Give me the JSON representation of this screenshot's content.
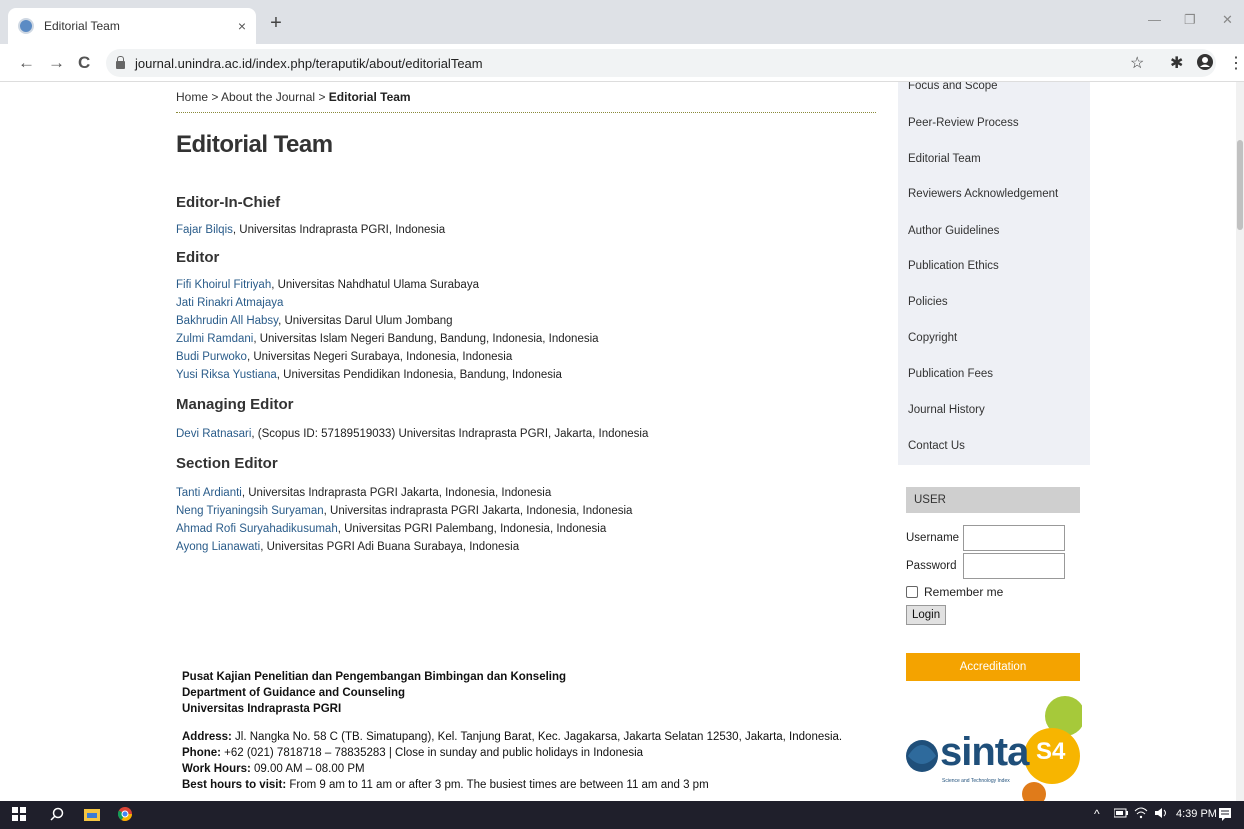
{
  "browser": {
    "tab_title": "Editorial Team",
    "tab_close": "×",
    "new_tab": "+",
    "url": "journal.unindra.ac.id/index.php/teraputik/about/editorialTeam",
    "back": "←",
    "forward": "→",
    "reload": "C",
    "star": "☆",
    "extensions": "✱",
    "menu": "⋮",
    "min": "—",
    "restore": "❐",
    "close": "✕"
  },
  "breadcrumb": {
    "home": "Home",
    "sep1": " > ",
    "about": "About the Journal",
    "sep2": " > ",
    "current": "Editorial Team"
  },
  "page_title": "Editorial Team",
  "sections": {
    "chief": {
      "heading": "Editor-In-Chief",
      "entries": [
        {
          "name": "Fajar Bilqis",
          "aff": ", Universitas Indraprasta PGRI, Indonesia"
        }
      ]
    },
    "editor": {
      "heading": "Editor",
      "entries": [
        {
          "name": "Fifi Khoirul Fitriyah",
          "aff": ", Universitas Nahdhatul Ulama Surabaya"
        },
        {
          "name": "Jati Rinakri Atmajaya",
          "aff": ""
        },
        {
          "name": "Bakhrudin All Habsy",
          "aff": ", Universitas Darul Ulum Jombang"
        },
        {
          "name": "Zulmi Ramdani",
          "aff": ", Universitas Islam Negeri Bandung, Bandung, Indonesia, Indonesia"
        },
        {
          "name": "Budi Purwoko",
          "aff": ", Universitas Negeri Surabaya, Indonesia, Indonesia"
        },
        {
          "name": "Yusi Riksa Yustiana",
          "aff": ", Universitas Pendidikan Indonesia, Bandung, Indonesia"
        }
      ]
    },
    "managing": {
      "heading": "Managing Editor",
      "entries": [
        {
          "name": "Devi Ratnasari",
          "aff": ", (Scopus ID: 57189519033) Universitas Indraprasta PGRI, Jakarta, Indonesia"
        }
      ]
    },
    "section": {
      "heading": "Section Editor",
      "entries": [
        {
          "name": "Tanti Ardianti",
          "aff": ", Universitas Indraprasta PGRI Jakarta, Indonesia, Indonesia"
        },
        {
          "name": "Neng Triyaningsih Suryaman",
          "aff": ", Universitas indraprasta PGRI Jakarta, Indonesia, Indonesia"
        },
        {
          "name": "Ahmad Rofi Suryahadikusumah",
          "aff": ", Universitas PGRI Palembang, Indonesia, Indonesia"
        },
        {
          "name": "Ayong Lianawati",
          "aff": ", Universitas PGRI Adi Buana Surabaya, Indonesia"
        }
      ]
    }
  },
  "footer": {
    "inst1": "Pusat Kajian Penelitian dan Pengembangan Bimbingan dan Konseling",
    "inst2": "Department of Guidance and Counseling",
    "inst3": "Universitas Indraprasta PGRI",
    "address_label": "Address:",
    "address": " Jl. Nangka No. 58 C (TB. Simatupang), Kel. Tanjung Barat, Kec. Jagakarsa, Jakarta Selatan 12530, Jakarta, Indonesia.",
    "phone_label": "Phone:",
    "phone": " +62 (021) 7818718 – 78835283 | Close in sunday and public holidays in Indonesia",
    "hours_label": "Work Hours:",
    "hours": " 09.00 AM – 08.00 PM",
    "best_label": "Best hours to visit:",
    "best": " From 9 am to 11 am or after 3 pm. The busiest times are between 11 am and 3 pm"
  },
  "sidebar": {
    "links": [
      "Focus and Scope",
      "Peer-Review Process",
      "Editorial Team",
      "Reviewers Acknowledgement",
      "Author Guidelines",
      "Publication Ethics",
      "Policies",
      "Copyright",
      "Publication Fees",
      "Journal History",
      "Contact Us"
    ],
    "user_heading": "USER",
    "username_label": "Username",
    "password_label": "Password",
    "remember_label": "Remember me",
    "login_label": "Login",
    "accreditation_label": "Accreditation",
    "sinta_text": "sinta",
    "sinta_badge": "S4",
    "sinta_sub": "Science and Technology Index"
  },
  "taskbar": {
    "time": "4:39 PM",
    "tray": "^"
  },
  "colors": {
    "link": "#2a5c8a",
    "accent": "#f4a300",
    "sidebar_bg": "#eef0f5"
  }
}
